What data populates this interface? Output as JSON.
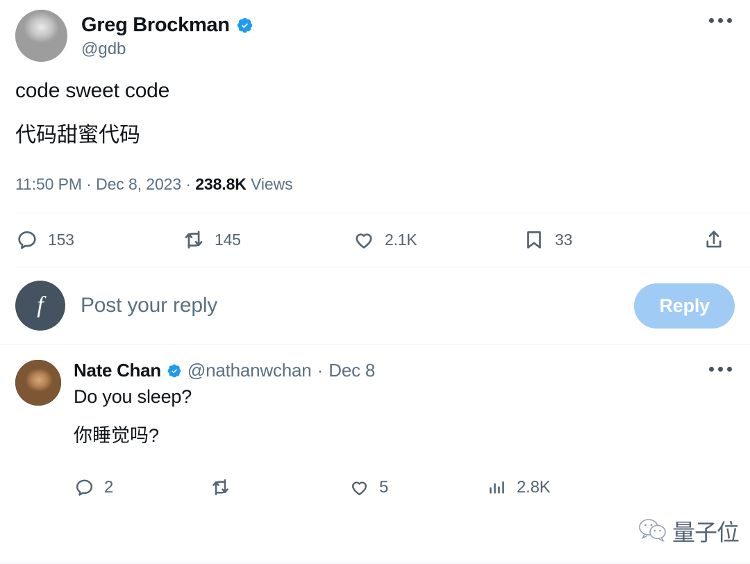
{
  "main_tweet": {
    "author_name": "Greg Brockman",
    "author_handle": "@gdb",
    "verified": true,
    "avatar": "greg-brockman-avatar",
    "text_en": "code sweet code",
    "text_zh": "代码甜蜜代码",
    "time": "11:50 PM",
    "date": "Dec 8, 2023",
    "views_count": "238.8K",
    "views_label": "Views",
    "meta_separator": "·",
    "more_icon": "more-options-icon",
    "actions": [
      {
        "icon": "reply-icon",
        "name": "reply",
        "count": "153"
      },
      {
        "icon": "retweet-icon",
        "name": "retweet",
        "count": "145"
      },
      {
        "icon": "like-icon",
        "name": "like",
        "count": "2.1K"
      },
      {
        "icon": "bookmark-icon",
        "name": "bookmark",
        "count": "33"
      },
      {
        "icon": "share-icon",
        "name": "share",
        "count": ""
      }
    ]
  },
  "composer": {
    "avatar": "user-avatar",
    "avatar_glyph": "f",
    "placeholder": "Post your reply",
    "button_label": "Reply",
    "button_color": "#9fcbf5",
    "button_text_color": "#ffffff"
  },
  "reply": {
    "author_name": "Nate Chan",
    "author_handle": "@nathanwchan",
    "verified": true,
    "avatar": "nate-chan-avatar",
    "separator": "·",
    "date": "Dec 8",
    "text_en": "Do you sleep?",
    "text_zh": "你睡觉吗?",
    "more_icon": "more-options-icon",
    "actions": [
      {
        "icon": "reply-icon",
        "name": "reply",
        "count": "2"
      },
      {
        "icon": "retweet-icon",
        "name": "retweet",
        "count": ""
      },
      {
        "icon": "like-icon",
        "name": "like",
        "count": "5"
      },
      {
        "icon": "analytics-icon",
        "name": "views",
        "count": "2.8K"
      }
    ]
  },
  "watermark": {
    "logo": "wechat-icon",
    "text": "量子位"
  },
  "colors": {
    "verified_blue": "#1d9bf0",
    "text_primary": "#0f1419",
    "text_secondary": "#5b7083",
    "icon": "#536471",
    "divider": "#eff3f4"
  }
}
